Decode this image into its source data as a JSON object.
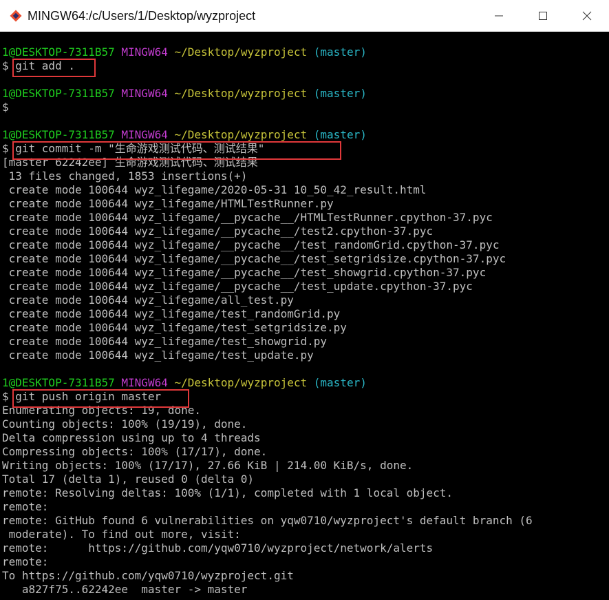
{
  "window": {
    "title": "MINGW64:/c/Users/1/Desktop/wyzproject",
    "icons": {
      "app": "git-bash-icon",
      "minimize": "minimize-icon",
      "maximize": "maximize-icon",
      "close": "close-icon"
    }
  },
  "colors": {
    "prompt_user": "#1fcf1f",
    "prompt_env": "#c23ccf",
    "prompt_path": "#c8c53a",
    "prompt_branch": "#2ab8c8",
    "highlight_box": "#e0383a"
  },
  "prompt": {
    "user": "1@DESKTOP-7311B57",
    "env": "MINGW64",
    "path": "~/Desktop/wyzproject",
    "branch": "(master)"
  },
  "commands": {
    "add": "$ git add .",
    "empty": "$",
    "commit": "$ git commit -m \"生命游戏测试代码、测试结果\"",
    "push": "$ git push origin master"
  },
  "commit_output": [
    "[master 62242ee] 生命游戏测试代码、测试结果",
    " 13 files changed, 1853 insertions(+)",
    " create mode 100644 wyz_lifegame/2020-05-31 10_50_42_result.html",
    " create mode 100644 wyz_lifegame/HTMLTestRunner.py",
    " create mode 100644 wyz_lifegame/__pycache__/HTMLTestRunner.cpython-37.pyc",
    " create mode 100644 wyz_lifegame/__pycache__/test2.cpython-37.pyc",
    " create mode 100644 wyz_lifegame/__pycache__/test_randomGrid.cpython-37.pyc",
    " create mode 100644 wyz_lifegame/__pycache__/test_setgridsize.cpython-37.pyc",
    " create mode 100644 wyz_lifegame/__pycache__/test_showgrid.cpython-37.pyc",
    " create mode 100644 wyz_lifegame/__pycache__/test_update.cpython-37.pyc",
    " create mode 100644 wyz_lifegame/all_test.py",
    " create mode 100644 wyz_lifegame/test_randomGrid.py",
    " create mode 100644 wyz_lifegame/test_setgridsize.py",
    " create mode 100644 wyz_lifegame/test_showgrid.py",
    " create mode 100644 wyz_lifegame/test_update.py"
  ],
  "push_output": [
    "Enumerating objects: 19, done.",
    "Counting objects: 100% (19/19), done.",
    "Delta compression using up to 4 threads",
    "Compressing objects: 100% (17/17), done.",
    "Writing objects: 100% (17/17), 27.66 KiB | 214.00 KiB/s, done.",
    "Total 17 (delta 1), reused 0 (delta 0)",
    "remote: Resolving deltas: 100% (1/1), completed with 1 local object.",
    "remote:",
    "remote: GitHub found 6 vulnerabilities on yqw0710/wyzproject's default branch (6",
    " moderate). To find out more, visit:",
    "remote:      https://github.com/yqw0710/wyzproject/network/alerts",
    "remote:",
    "To https://github.com/yqw0710/wyzproject.git",
    "   a827f75..62242ee  master -> master"
  ]
}
